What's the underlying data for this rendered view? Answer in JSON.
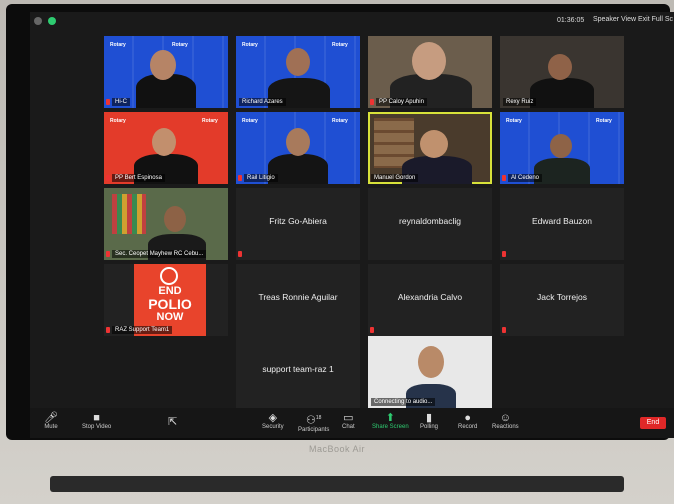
{
  "device": {
    "brand": "MacBook Air"
  },
  "topbar": {
    "time": "01:36:05",
    "speaker_view": "Speaker View",
    "exit_full": "Exit Full Sc"
  },
  "tiles": [
    {
      "label": "Hi-C"
    },
    {
      "label": "Richard Azares"
    },
    {
      "label": "PP Caloy Apuhin"
    },
    {
      "label": "Rexy Ruiz"
    },
    {
      "label": "PP Bert Espinosa"
    },
    {
      "label": "Rail Litigio"
    },
    {
      "label": "Manuel Gordon"
    },
    {
      "label": "Al Cedeno"
    },
    {
      "label": "Sec. Ceopet Mayhew RC Cebu..."
    },
    {
      "name": "Fritz Go-Abiera"
    },
    {
      "name": "reynaldombaclig"
    },
    {
      "name": "Edward Bauzon"
    },
    {
      "label": "RAZ Support Team1",
      "poster_top": "END",
      "poster_mid": "POLIO",
      "poster_bot": "NOW"
    },
    {
      "name": "Treas Ronnie Aguilar"
    },
    {
      "name": "Alexandria Calvo"
    },
    {
      "name": "Jack Torrejos"
    },
    {
      "name": "support team-raz 1"
    },
    {
      "label": "Connecting to audio..."
    }
  ],
  "rotary_badge": "Rotary",
  "toolbar": {
    "mute": "Mute",
    "stop_video": "Stop Video",
    "security": "Security",
    "participants": "Participants",
    "participants_count": "18",
    "chat": "Chat",
    "share": "Share Screen",
    "polling": "Polling",
    "record": "Record",
    "reactions": "Reactions",
    "end": "End"
  },
  "colors": {
    "accent_green": "#2ecc71",
    "end_red": "#e02828",
    "rotary_blue": "#1f4fd3",
    "speaker_yellow": "#d8e23a"
  }
}
